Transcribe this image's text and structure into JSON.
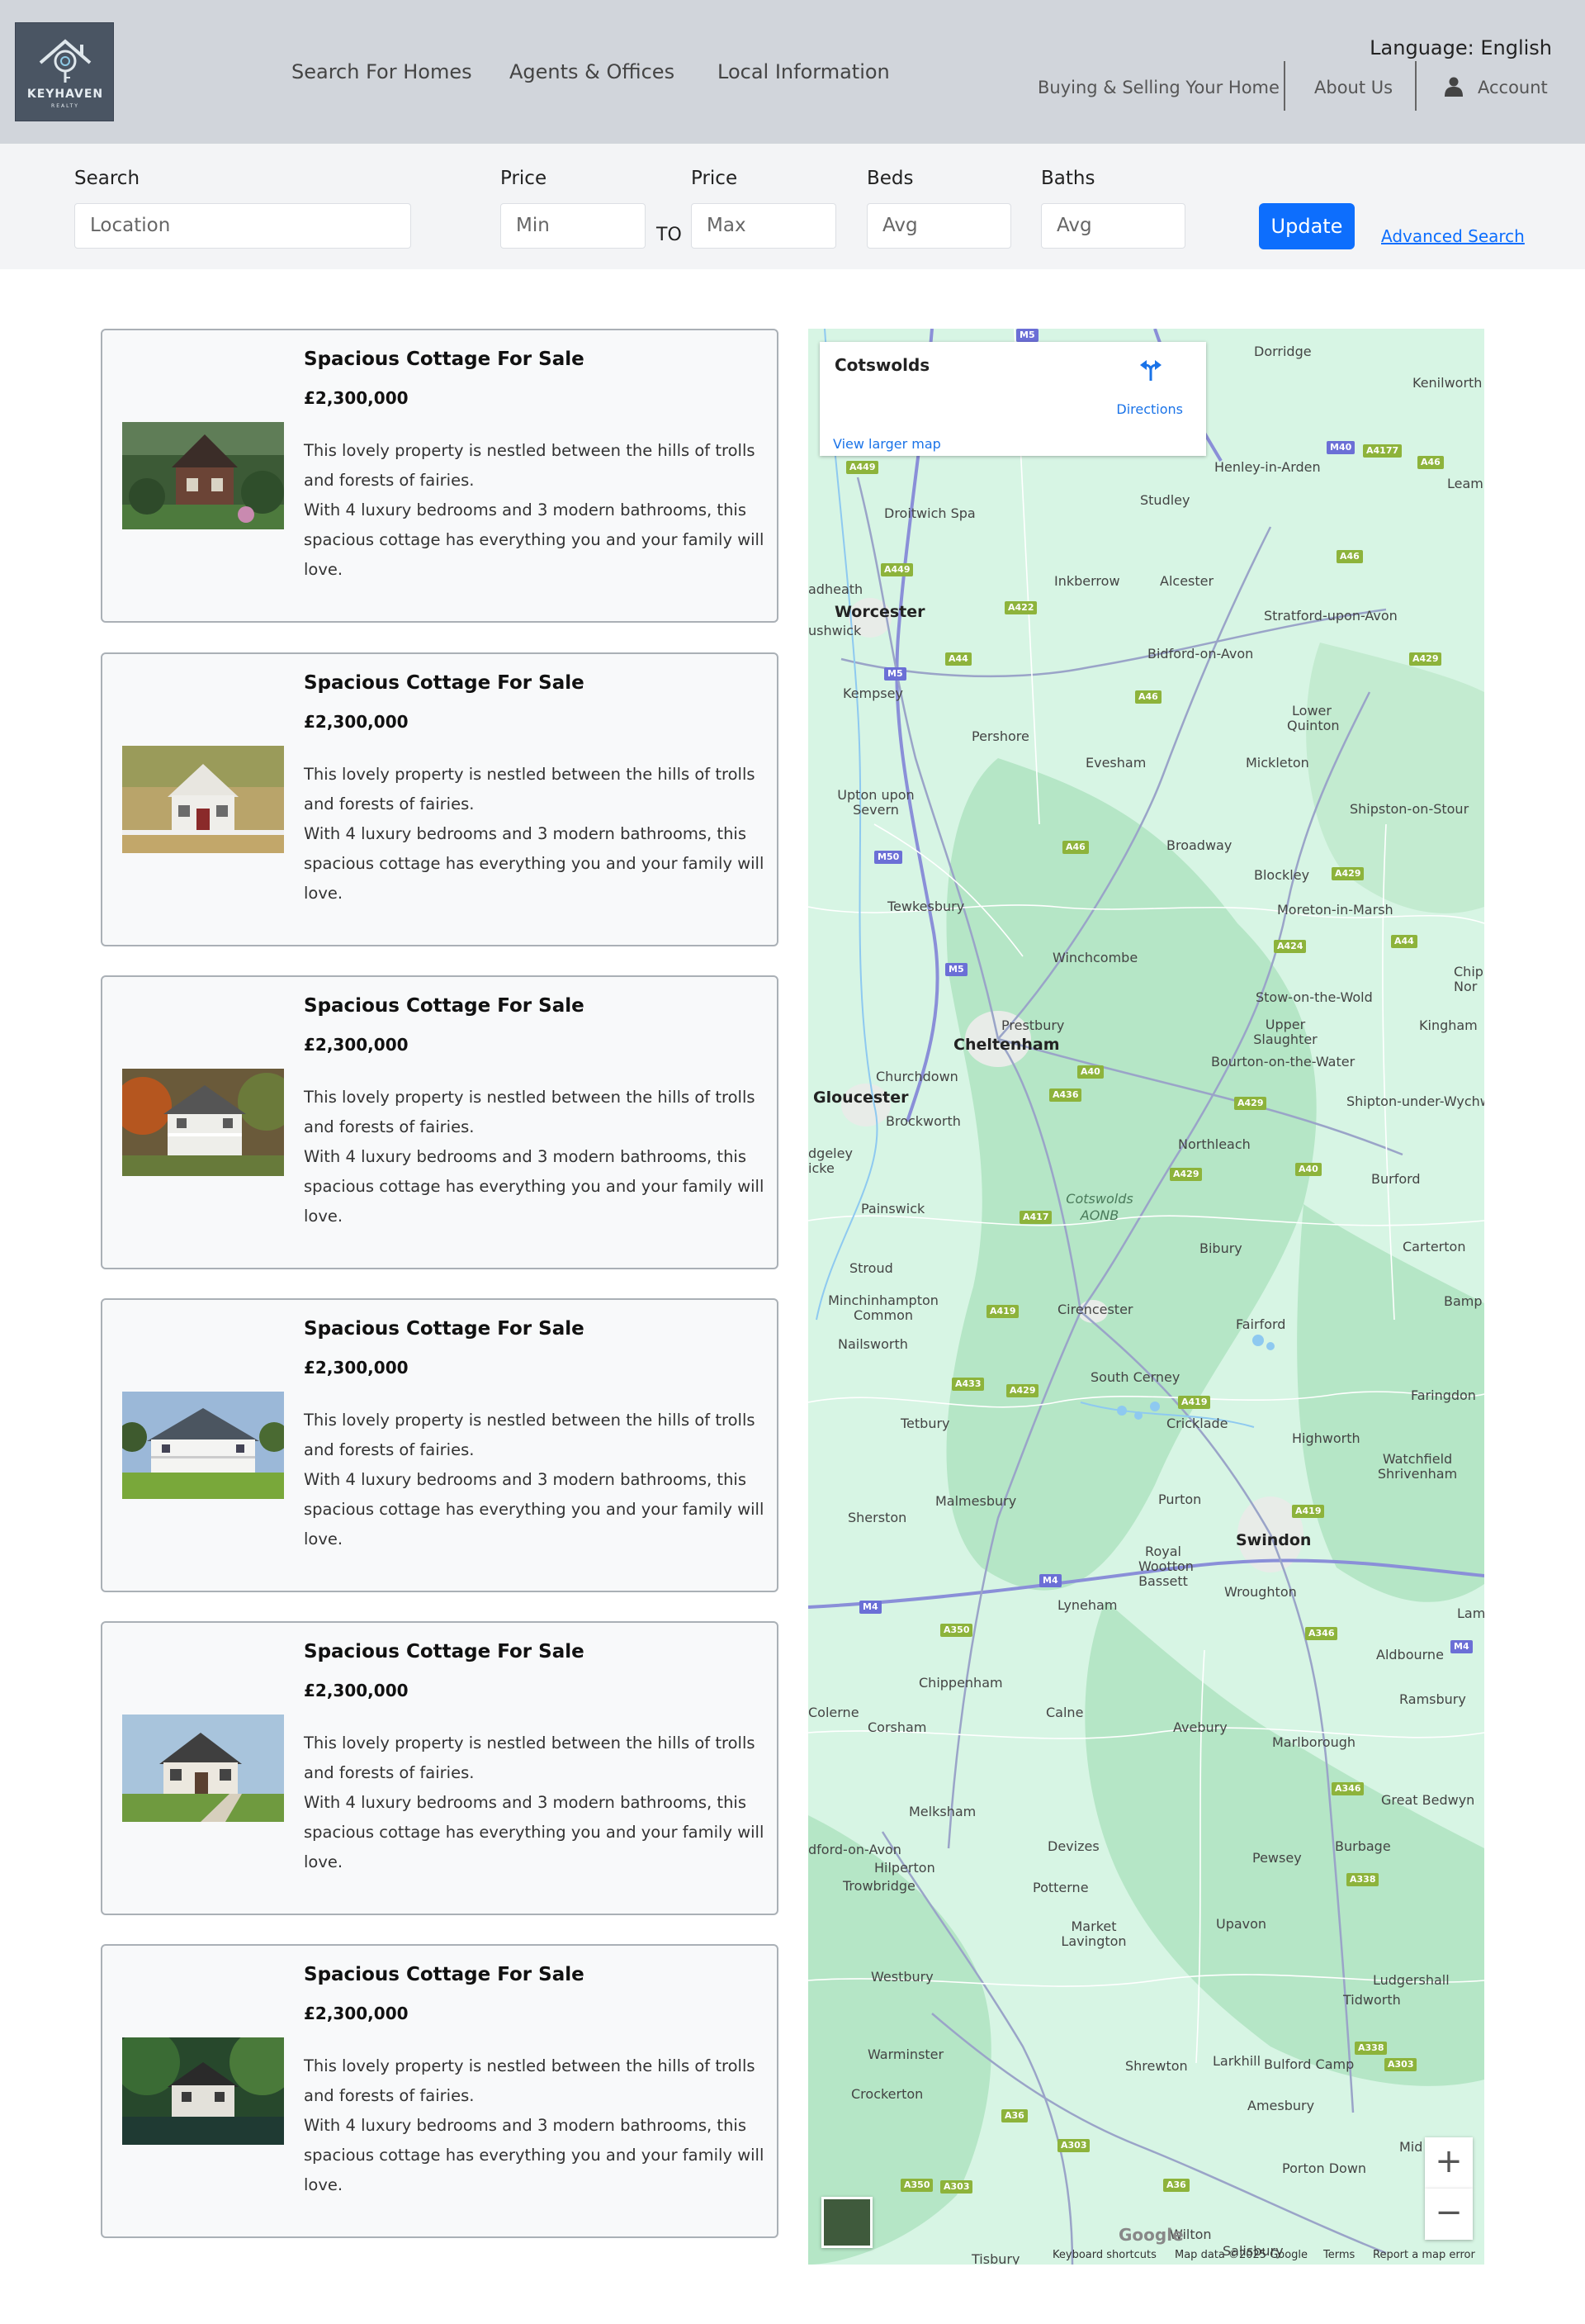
{
  "header": {
    "logo": {
      "name": "KEYHAVEN",
      "sub": "REALTY"
    },
    "nav_main": [
      "Search For Homes",
      "Agents & Offices",
      "Local Information"
    ],
    "language": "Language: English",
    "nav_sub": {
      "buying_selling": "Buying & Selling Your Home",
      "about": "About Us",
      "account": "Account"
    }
  },
  "search": {
    "location_label": "Search",
    "location_placeholder": "Location",
    "price_min_label": "Price",
    "price_min_placeholder": "Min",
    "to_label": "TO",
    "price_max_label": "Price",
    "price_max_placeholder": "Max",
    "beds_label": "Beds",
    "beds_placeholder": "Avg",
    "baths_label": "Baths",
    "baths_placeholder": "Avg",
    "update_label": "Update",
    "advanced_label": "Advanced Search"
  },
  "listings": [
    {
      "title": "Spacious Cottage For Sale",
      "price": "£2,300,000",
      "desc1": "This lovely property is nestled between the hills of trolls and forests of fairies.",
      "desc2": "With 4 luxury bedrooms and 3 modern bathrooms, this spacious cottage has everything you and your family will love.",
      "image": "brick cottage among trees"
    },
    {
      "title": "Spacious Cottage For Sale",
      "price": "£2,300,000",
      "desc1": "This lovely property is nestled between the hills of trolls and forests of fairies.",
      "desc2": "With 4 luxury bedrooms and 3 modern bathrooms, this spacious cottage has everything you and your family will love.",
      "image": "white cottage with picket fence"
    },
    {
      "title": "Spacious Cottage For Sale",
      "price": "£2,300,000",
      "desc1": "This lovely property is nestled between the hills of trolls and forests of fairies.",
      "desc2": "With 4 luxury bedrooms and 3 modern bathrooms, this spacious cottage has everything you and your family will love.",
      "image": "white house with porch in autumn"
    },
    {
      "title": "Spacious Cottage For Sale",
      "price": "£2,300,000",
      "desc1": "This lovely property is nestled between the hills of trolls and forests of fairies.",
      "desc2": "With 4 luxury bedrooms and 3 modern bathrooms, this spacious cottage has everything you and your family will love.",
      "image": "large white house with lawn"
    },
    {
      "title": "Spacious Cottage For Sale",
      "price": "£2,300,000",
      "desc1": "This lovely property is nestled between the hills of trolls and forests of fairies.",
      "desc2": "With 4 luxury bedrooms and 3 modern bathrooms, this spacious cottage has everything you and your family will love.",
      "image": "modern farmhouse with lawn"
    },
    {
      "title": "Spacious Cottage For Sale",
      "price": "£2,300,000",
      "desc1": "This lovely property is nestled between the hills of trolls and forests of fairies.",
      "desc2": "With 4 luxury bedrooms and 3 modern bathrooms, this spacious cottage has everything you and your family will love.",
      "image": "white house by the water in forest"
    }
  ],
  "map": {
    "info_title": "Cotswolds",
    "directions": "Directions",
    "larger_map": "View larger map",
    "attribution": {
      "shortcuts": "Keyboard shortcuts",
      "data": "Map data ©2025 Google",
      "terms": "Terms",
      "report": "Report a map error"
    },
    "google": "Google",
    "places": [
      "Dorridge",
      "Kenilworth",
      "Henley-in-Arden",
      "Leam",
      "Droitwich Spa",
      "Studley",
      "Inkberrow",
      "Alcester",
      "adheath",
      "Worcester",
      "ushwick",
      "Stratford-upon-Avon",
      "Bidford-on-Avon",
      "Kempsey",
      "Pershore",
      "Lower Quinton",
      "Evesham",
      "Mickleton",
      "Upton upon Severn",
      "Shipston-on-Stour",
      "Broadway",
      "Blockley",
      "Tewkesbury",
      "Moreton-in-Marsh",
      "Winchcombe",
      "Chip Nor",
      "Stow-on-the-Wold",
      "Prestbury",
      "Upper Slaughter",
      "Kingham",
      "Cheltenham",
      "Bourton-on-the-Water",
      "Churchdown",
      "Gloucester",
      "Shipton-under-Wychw",
      "Brockworth",
      "Northleach",
      "dgeley icke",
      "Burford",
      "Cotswolds AONB",
      "Painswick",
      "Bibury",
      "Carterton",
      "Stroud",
      "Minchinhampton Common",
      "Cirencester",
      "Bamp",
      "Fairford",
      "Nailsworth",
      "South Cerney",
      "Faringdon",
      "Tetbury",
      "Cricklade",
      "Highworth",
      "Watchfield Shrivenham",
      "Malmesbury",
      "Purton",
      "Sherston",
      "Swindon",
      "Royal Wootton Bassett",
      "Wroughton",
      "Lyneham",
      "Lam",
      "Aldbourne",
      "Chippenham",
      "Ramsbury",
      "Colerne",
      "Calne",
      "Corsham",
      "Avebury",
      "Marlborough",
      "Melksham",
      "Great Bedwyn",
      "dford-on-Avon",
      "Devizes",
      "Pewsey",
      "Burbage",
      "Hilperton",
      "Trowbridge",
      "Potterne",
      "Market Lavington",
      "Upavon",
      "Westbury",
      "Ludgershall",
      "Tidworth",
      "Warminster",
      "Shrewton",
      "Larkhill",
      "Bulford Camp",
      "Crockerton",
      "Amesbury",
      "Mid",
      "Porton Down",
      "Wilton",
      "Salisbury",
      "Tisbury"
    ],
    "roads": [
      "M5",
      "A449",
      "M40",
      "A4177",
      "A46",
      "A449",
      "A422",
      "A46",
      "A44",
      "M5",
      "A46",
      "A429",
      "M50",
      "A46",
      "A429",
      "A424",
      "A44",
      "M5",
      "A40",
      "A436",
      "A429",
      "A429",
      "A40",
      "A417",
      "A419",
      "A433",
      "A429",
      "A419",
      "A419",
      "M4",
      "M4",
      "A350",
      "A346",
      "M4",
      "A346",
      "A338",
      "A338",
      "A303",
      "A36",
      "A303",
      "A350",
      "A303",
      "A36"
    ]
  },
  "colors": {
    "header_bg": "#d1d5db",
    "search_bg": "#f3f4f6",
    "accent": "#0d6efd",
    "map_green": "#ccf0dc",
    "map_forest": "#a7dfb8"
  }
}
